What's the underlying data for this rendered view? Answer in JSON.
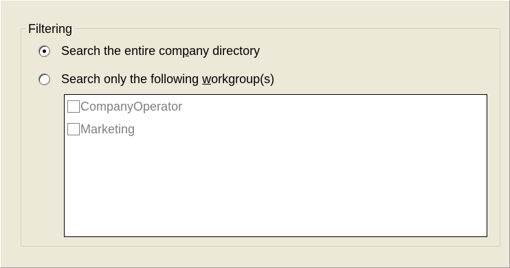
{
  "filtering": {
    "legend": "Filtering",
    "options": [
      {
        "label_before": "Search the entire com",
        "label_accel": "p",
        "label_after": "any directory",
        "selected": true
      },
      {
        "label_before": "Search only the following ",
        "label_accel": "w",
        "label_after": "orkgroup(s)",
        "selected": false
      }
    ],
    "workgroups": [
      {
        "label": "CompanyOperator",
        "checked": false,
        "enabled": false
      },
      {
        "label": "Marketing",
        "checked": false,
        "enabled": false
      }
    ]
  },
  "colors": {
    "face": "#ece9d8",
    "disabled_text": "#808080",
    "group_border": "#d0d0bf"
  }
}
